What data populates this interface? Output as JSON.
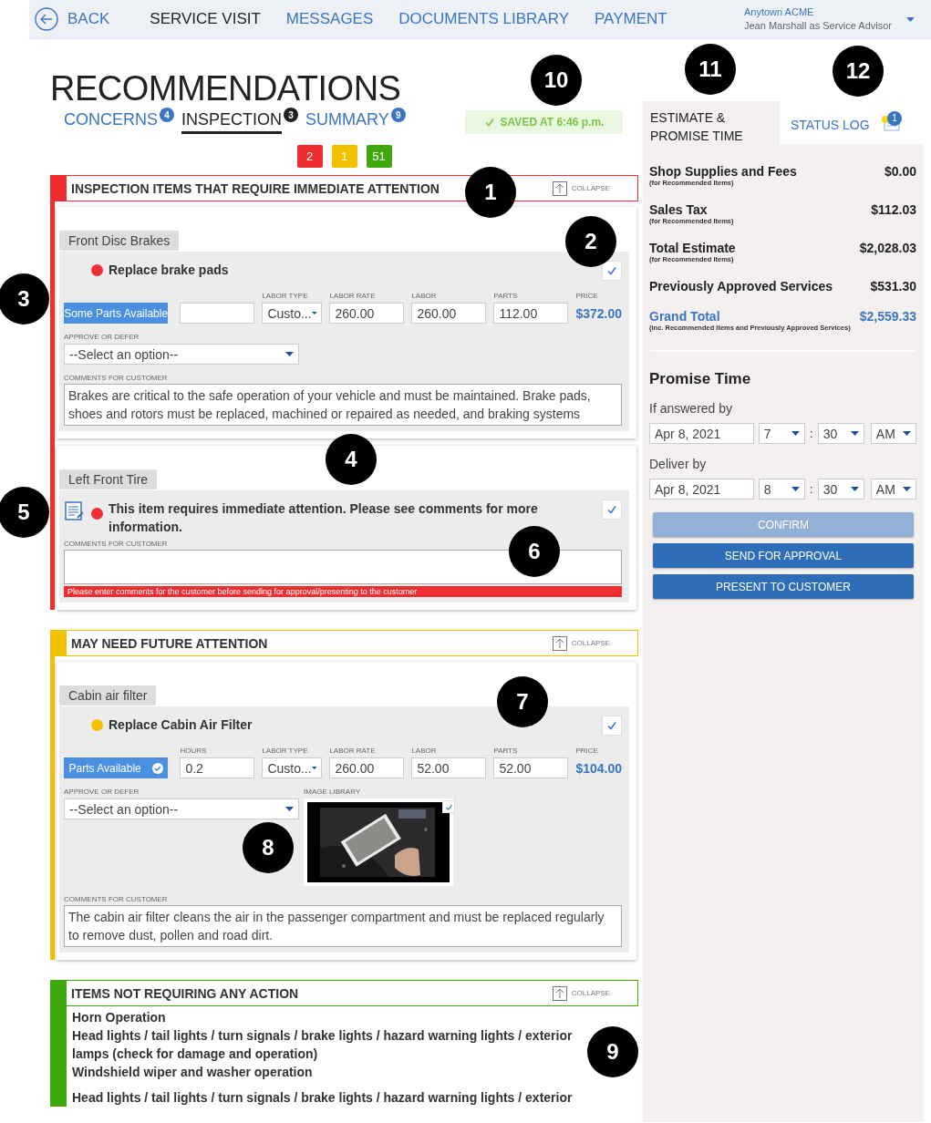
{
  "nav": {
    "back": "BACK",
    "items": [
      {
        "label": "SERVICE VISIT",
        "selected": true
      },
      {
        "label": "MESSAGES",
        "selected": false
      },
      {
        "label": "DOCUMENTS LIBRARY",
        "selected": false
      },
      {
        "label": "PAYMENT",
        "selected": false
      }
    ],
    "account": {
      "shop": "Anytown ACME",
      "user": "Jean Marshall as Service Advisor"
    }
  },
  "page_title": "RECOMMENDATIONS",
  "tabs": [
    {
      "label": "CONCERNS",
      "count": "4",
      "selected": false
    },
    {
      "label": "INSPECTION",
      "count": "3",
      "selected": true
    },
    {
      "label": "SUMMARY",
      "count": "9",
      "selected": false
    }
  ],
  "saved_status": "SAVED AT 6:46 p.m.",
  "severity_counts": [
    {
      "count": "2",
      "color": "#ee2e31"
    },
    {
      "count": "1",
      "color": "#f2c200"
    },
    {
      "count": "51",
      "color": "#3fa80a"
    }
  ],
  "sections": [
    {
      "title": "INSPECTION ITEMS THAT REQUIRE IMMEDIATE ATTENTION",
      "color": "#ee2e31",
      "collapse": "COLLAPSE",
      "kind": "cards",
      "items": [
        {
          "kind": "service",
          "category": "Front Disc Brakes",
          "title": "Replace brake pads",
          "checked": true,
          "parts_status": "Some Parts Available",
          "parts_ok": false,
          "fields": [
            {
              "kind": "input"
            },
            {
              "kind": "select",
              "label": "LABOR TYPE",
              "value": "Custo..."
            },
            {
              "kind": "input",
              "label": "LABOR RATE",
              "value": "260.00"
            },
            {
              "kind": "input",
              "label": "LABOR",
              "value": "260.00"
            },
            {
              "kind": "input",
              "label": "PARTS",
              "value": "112.00"
            }
          ],
          "price": {
            "label": "PRICE",
            "value": "$372.00"
          },
          "approve": {
            "label": "APPROVE OR DEFER",
            "value": "--Select an option--"
          },
          "comments": {
            "label": "COMMENTS FOR CUSTOMER",
            "value": "Brakes are critical to the safe operation of your vehicle and must be maintained. Brake pads, shoes and rotors must be replaced, machined or repaired as needed, and braking systems"
          }
        },
        {
          "kind": "notice",
          "category": "Left Front Tire",
          "title": "This item requires immediate attention. Please see comments for more information.",
          "checked": true,
          "comments": {
            "label": "COMMENTS FOR CUSTOMER",
            "error": "Please enter comments for the customer before sending for approval/presenting to the customer"
          }
        }
      ]
    },
    {
      "title": "MAY NEED FUTURE ATTENTION",
      "color": "#f2c200",
      "collapse": "COLLAPSE",
      "kind": "cards",
      "items": [
        {
          "kind": "service",
          "category": "Cabin air filter",
          "title": "Replace Cabin Air Filter",
          "checked": true,
          "parts_status": "Parts Available",
          "parts_ok": true,
          "fields": [
            {
              "kind": "input",
              "label": "HOURS",
              "value": "0.2"
            },
            {
              "kind": "select",
              "label": "LABOR TYPE",
              "value": "Custo..."
            },
            {
              "kind": "input",
              "label": "LABOR RATE",
              "value": "260.00"
            },
            {
              "kind": "input",
              "label": "LABOR",
              "value": "52.00"
            },
            {
              "kind": "input",
              "label": "PARTS",
              "value": "52.00"
            }
          ],
          "price": {
            "label": "PRICE",
            "value": "$104.00"
          },
          "approve": {
            "label": "APPROVE OR DEFER",
            "value": "--Select an option--"
          },
          "image_library": {
            "label": "IMAGE LIBRARY",
            "image": {
              "kind": "picture",
              "checked": true
            }
          },
          "comments": {
            "label": "COMMENTS FOR CUSTOMER",
            "value": "The cabin air filter cleans the air in the passenger compartment and must be replaced regularly to remove dust, pollen and road dirt."
          }
        }
      ]
    },
    {
      "title": "ITEMS NOT REQUIRING ANY ACTION",
      "color": "#3fa80a",
      "collapse": "COLLAPSE",
      "kind": "list",
      "lines": [
        "Horn Operation",
        "Head lights / tail lights / turn signals / brake lights / hazard warning lights / exterior lamps (check for damage and operation)",
        "Windshield wiper and washer operation"
      ],
      "overflow_lines": [
        "Head lights / tail lights / turn signals / brake lights / hazard warning lights / exterior"
      ]
    }
  ],
  "side_tabs": [
    {
      "label": "ESTIMATE & PROMISE TIME",
      "selected": true
    },
    {
      "label": "STATUS LOG",
      "count": "1",
      "selected": false
    }
  ],
  "estimate": [
    {
      "kind": "line",
      "label": "Shop Supplies and Fees",
      "note": "(for Recommended Items)",
      "amount": "$0.00"
    },
    {
      "kind": "line",
      "label": "Sales Tax",
      "note": "(for Recommended Items)",
      "amount": "$112.03"
    },
    {
      "kind": "line",
      "label": "Total Estimate",
      "note": "(for Recommended Items)",
      "amount": "$2,028.03"
    },
    {
      "kind": "line",
      "label": "Previously Approved Services",
      "amount": "$531.30"
    },
    {
      "kind": "grand",
      "label": "Grand Total",
      "note": "(inc. Recommended Items and Previously Approved Services)",
      "amount": "$2,559.33"
    }
  ],
  "promise": {
    "title": "Promise Time",
    "rows": [
      {
        "label": "If answered by",
        "date": "Apr 8, 2021",
        "hour": "7",
        "separator": ":",
        "minute": "30",
        "period": "AM"
      },
      {
        "label": "Deliver by",
        "date": "Apr 8, 2021",
        "hour": "8",
        "separator": ":",
        "minute": "30",
        "period": "AM"
      }
    ]
  },
  "actions": [
    {
      "label": "CONFIRM",
      "disabled": true
    },
    {
      "label": "SEND FOR APPROVAL",
      "disabled": false
    },
    {
      "label": "PRESENT TO CUSTOMER",
      "disabled": false
    }
  ],
  "callouts": [
    "1",
    "2",
    "3",
    "4",
    "5",
    "6",
    "7",
    "8",
    "9",
    "10",
    "11",
    "12"
  ]
}
